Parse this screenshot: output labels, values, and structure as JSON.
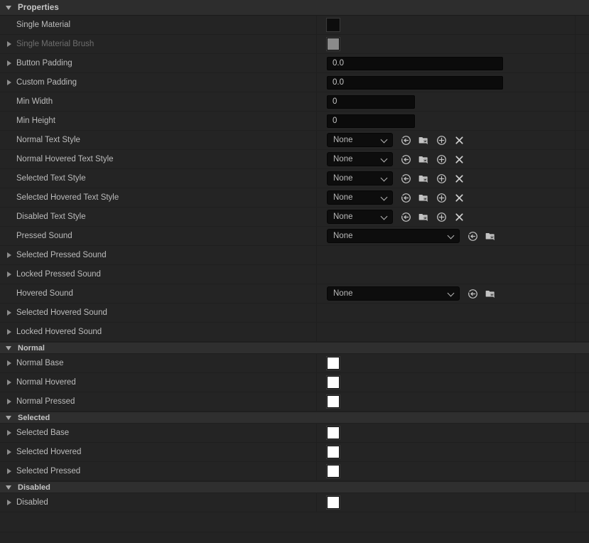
{
  "panel": {
    "category_header": {
      "label": "Properties",
      "expanded": true
    },
    "colors": {
      "row_bg": "#242424",
      "section_header_bg": "#2f2f2f",
      "category_header_bg": "#2d2d2d",
      "divider": "#1f1f1f",
      "label_text": "#bcbcbc",
      "label_text_disabled": "#6e6e6e",
      "field_bg": "#0b0b0b",
      "swatch_white": "#ffffff",
      "swatch_black": "#0d0d0d",
      "swatch_gray": "#8a8a8a"
    },
    "icon_names": {
      "use_selected": "use-selected-asset-icon",
      "browse": "browse-to-asset-icon",
      "new_asset": "new-asset-icon",
      "clear": "clear-asset-icon",
      "expand": "expand-triangle-icon",
      "collapse": "collapse-triangle-icon",
      "dropdown": "chevron-down-icon"
    },
    "rows": [
      {
        "id": "single-material",
        "label": "Single Material",
        "tri": "none",
        "dim": false,
        "control": "swatch",
        "swatch": "#0d0d0d"
      },
      {
        "id": "single-material-brush",
        "label": "Single Material Brush",
        "tri": "collapsed",
        "dim": true,
        "control": "swatch",
        "swatch": "#8a8a8a"
      },
      {
        "id": "button-padding",
        "label": "Button Padding",
        "tri": "collapsed",
        "dim": false,
        "control": "num-wide",
        "value": "0.0"
      },
      {
        "id": "custom-padding",
        "label": "Custom Padding",
        "tri": "collapsed",
        "dim": false,
        "control": "num-wide",
        "value": "0.0"
      },
      {
        "id": "min-width",
        "label": "Min Width",
        "tri": "none",
        "dim": false,
        "control": "num-narrow",
        "value": "0"
      },
      {
        "id": "min-height",
        "label": "Min Height",
        "tri": "none",
        "dim": false,
        "control": "num-narrow",
        "value": "0"
      },
      {
        "id": "normal-text-style",
        "label": "Normal Text Style",
        "tri": "none",
        "dim": false,
        "control": "asset-small",
        "value": "None"
      },
      {
        "id": "normal-hovered-text-style",
        "label": "Normal Hovered Text Style",
        "tri": "none",
        "dim": false,
        "control": "asset-small",
        "value": "None"
      },
      {
        "id": "selected-text-style",
        "label": "Selected Text Style",
        "tri": "none",
        "dim": false,
        "control": "asset-small",
        "value": "None"
      },
      {
        "id": "selected-hovered-text-style",
        "label": "Selected Hovered Text Style",
        "tri": "none",
        "dim": false,
        "control": "asset-small",
        "value": "None"
      },
      {
        "id": "disabled-text-style",
        "label": "Disabled Text Style",
        "tri": "none",
        "dim": false,
        "control": "asset-small",
        "value": "None"
      },
      {
        "id": "pressed-sound",
        "label": "Pressed Sound",
        "tri": "none",
        "dim": false,
        "control": "asset-large",
        "value": "None"
      },
      {
        "id": "selected-pressed-sound",
        "label": "Selected Pressed Sound",
        "tri": "collapsed",
        "dim": false,
        "control": "empty"
      },
      {
        "id": "locked-pressed-sound",
        "label": "Locked Pressed Sound",
        "tri": "collapsed",
        "dim": false,
        "control": "empty"
      },
      {
        "id": "hovered-sound",
        "label": "Hovered Sound",
        "tri": "none",
        "dim": false,
        "control": "asset-large",
        "value": "None"
      },
      {
        "id": "selected-hovered-sound",
        "label": "Selected Hovered Sound",
        "tri": "collapsed",
        "dim": false,
        "control": "empty"
      },
      {
        "id": "locked-hovered-sound",
        "label": "Locked Hovered Sound",
        "tri": "collapsed",
        "dim": false,
        "control": "empty"
      },
      {
        "id": "section-normal",
        "label": "Normal",
        "section": true
      },
      {
        "id": "normal-base",
        "label": "Normal Base",
        "tri": "collapsed",
        "dim": false,
        "control": "swatch",
        "swatch": "#ffffff"
      },
      {
        "id": "normal-hovered",
        "label": "Normal Hovered",
        "tri": "collapsed",
        "dim": false,
        "control": "swatch",
        "swatch": "#ffffff"
      },
      {
        "id": "normal-pressed",
        "label": "Normal Pressed",
        "tri": "collapsed",
        "dim": false,
        "control": "swatch",
        "swatch": "#ffffff"
      },
      {
        "id": "section-selected",
        "label": "Selected",
        "section": true
      },
      {
        "id": "selected-base",
        "label": "Selected Base",
        "tri": "collapsed",
        "dim": false,
        "control": "swatch",
        "swatch": "#ffffff"
      },
      {
        "id": "selected-hovered",
        "label": "Selected Hovered",
        "tri": "collapsed",
        "dim": false,
        "control": "swatch",
        "swatch": "#ffffff"
      },
      {
        "id": "selected-pressed",
        "label": "Selected Pressed",
        "tri": "collapsed",
        "dim": false,
        "control": "swatch",
        "swatch": "#ffffff"
      },
      {
        "id": "section-disabled",
        "label": "Disabled",
        "section": true
      },
      {
        "id": "disabled",
        "label": "Disabled",
        "tri": "collapsed",
        "dim": false,
        "control": "swatch",
        "swatch": "#ffffff"
      }
    ]
  }
}
